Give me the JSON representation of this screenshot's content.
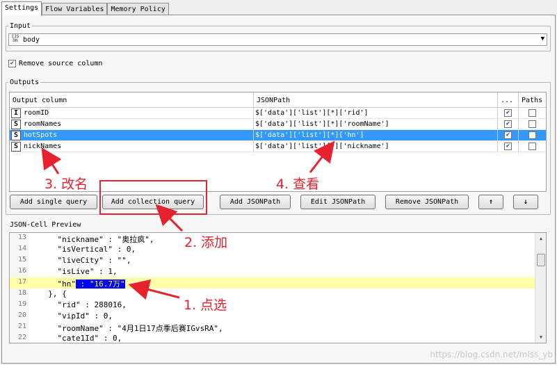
{
  "tabs": [
    {
      "label": "Settings",
      "active": true
    },
    {
      "label": "Flow Variables",
      "active": false
    },
    {
      "label": "Memory Policy",
      "active": false
    }
  ],
  "input": {
    "legend": "Input",
    "selected": "body",
    "icon": "json-icon"
  },
  "remove_source": {
    "label": "Remove source column",
    "checked": true
  },
  "outputs": {
    "legend": "Outputs",
    "columns": [
      "Output column",
      "JSONPath",
      "...",
      "Paths"
    ],
    "rows": [
      {
        "type": "I",
        "name": "roomID",
        "path": "$['data']['list'][*]['rid']",
        "checked": true,
        "paths": false,
        "selected": false
      },
      {
        "type": "S",
        "name": "roomNames",
        "path": "$['data']['list'][*]['roomName']",
        "checked": true,
        "paths": false,
        "selected": false
      },
      {
        "type": "S",
        "name": "hotSpots",
        "path": "$['data']['list'][*]['hn']",
        "checked": true,
        "paths": false,
        "selected": true
      },
      {
        "type": "S",
        "name": "nickNames",
        "path": "$['data']['list'][*]['nickname']",
        "checked": true,
        "paths": false,
        "selected": false
      }
    ]
  },
  "buttons": {
    "add_single": "Add single query",
    "add_collection": "Add collection query",
    "add_jsonpath": "Add JSONPath",
    "edit_jsonpath": "Edit JSONPath",
    "remove_jsonpath": "Remove JSONPath",
    "up": "↑",
    "down": "↓"
  },
  "preview": {
    "legend": "JSON-Cell Preview",
    "lines": [
      {
        "n": "13",
        "text": "    \"nickname\" : \"奥拉疯\","
      },
      {
        "n": "14",
        "text": "    \"isVertical\" : 0,"
      },
      {
        "n": "15",
        "text": "    \"liveCity\" : \"\","
      },
      {
        "n": "16",
        "text": "    \"isLive\" : 1,"
      },
      {
        "n": "17",
        "text": "    \"hn\"",
        "sel": " : \"16.7万\"",
        "highlight": true
      },
      {
        "n": "18",
        "text": "  }, {"
      },
      {
        "n": "19",
        "text": "    \"rid\" : 288016,"
      },
      {
        "n": "20",
        "text": "    \"vipId\" : 0,"
      },
      {
        "n": "21",
        "text": "    \"roomName\" : \"4月1日17点季后赛IGvsRA\","
      },
      {
        "n": "22",
        "text": "    \"cate1Id\" : 0,"
      }
    ]
  },
  "annotations": {
    "a1": "1. 点选",
    "a2": "2. 添加",
    "a3": "3. 改名",
    "a4": "4. 查看",
    "color": "#e8212e"
  },
  "watermark": "https://blog.csdn.net/mlss_yb"
}
